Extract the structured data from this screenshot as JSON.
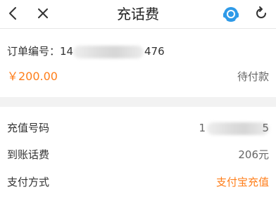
{
  "header": {
    "title": "充话费",
    "back_icon": "chevron-left-icon",
    "close_icon": "close-icon",
    "service_icon": "customer-service-icon",
    "refresh_icon": "refresh-icon"
  },
  "order": {
    "number_label": "订单编号：",
    "number_prefix": "14",
    "number_suffix": "476",
    "amount": "￥200.00",
    "status": "待付款"
  },
  "details": {
    "phone_label": "充值号码",
    "phone_prefix": "1",
    "phone_suffix": "5",
    "credit_label": "到账话费",
    "credit_value": "206元",
    "payment_label": "支付方式",
    "payment_value": "支付宝充值"
  },
  "colors": {
    "accent": "#ff7e1a",
    "service_icon": "#2f9ae8"
  }
}
